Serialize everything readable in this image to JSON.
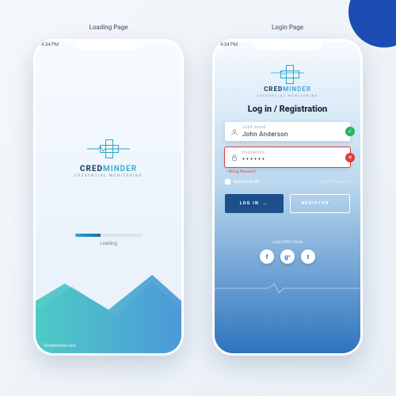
{
  "captions": {
    "loading": "Loading Page",
    "login": "Login Page"
  },
  "status_time": "4:34 PM",
  "brand": {
    "part1": "CRED",
    "part2": "MINDER",
    "tagline": "CREDENTIAL MONITORING"
  },
  "loading": {
    "text": "Loading",
    "progress_pct": 38
  },
  "copyright": "©Credminder.com",
  "login": {
    "title": "Log in / Registration",
    "username": {
      "label": "USER NAME",
      "value": "John Anderson",
      "status": "ok"
    },
    "password": {
      "label": "PASSWORD",
      "value": "••••••",
      "status": "error"
    },
    "error_msg": "• Wrong Password",
    "remember": "Remember Me",
    "forgot": "Forgot Password",
    "login_btn": "LOG IN",
    "register_btn": "REGISTER",
    "social_label": "Login With Social",
    "social": {
      "fb": "f",
      "google": "g⁺",
      "twitter": "t"
    }
  },
  "colors": {
    "primary_dark": "#1d4f8b",
    "accent": "#2aa6c9",
    "error": "#e23b3b",
    "success": "#28b463"
  }
}
